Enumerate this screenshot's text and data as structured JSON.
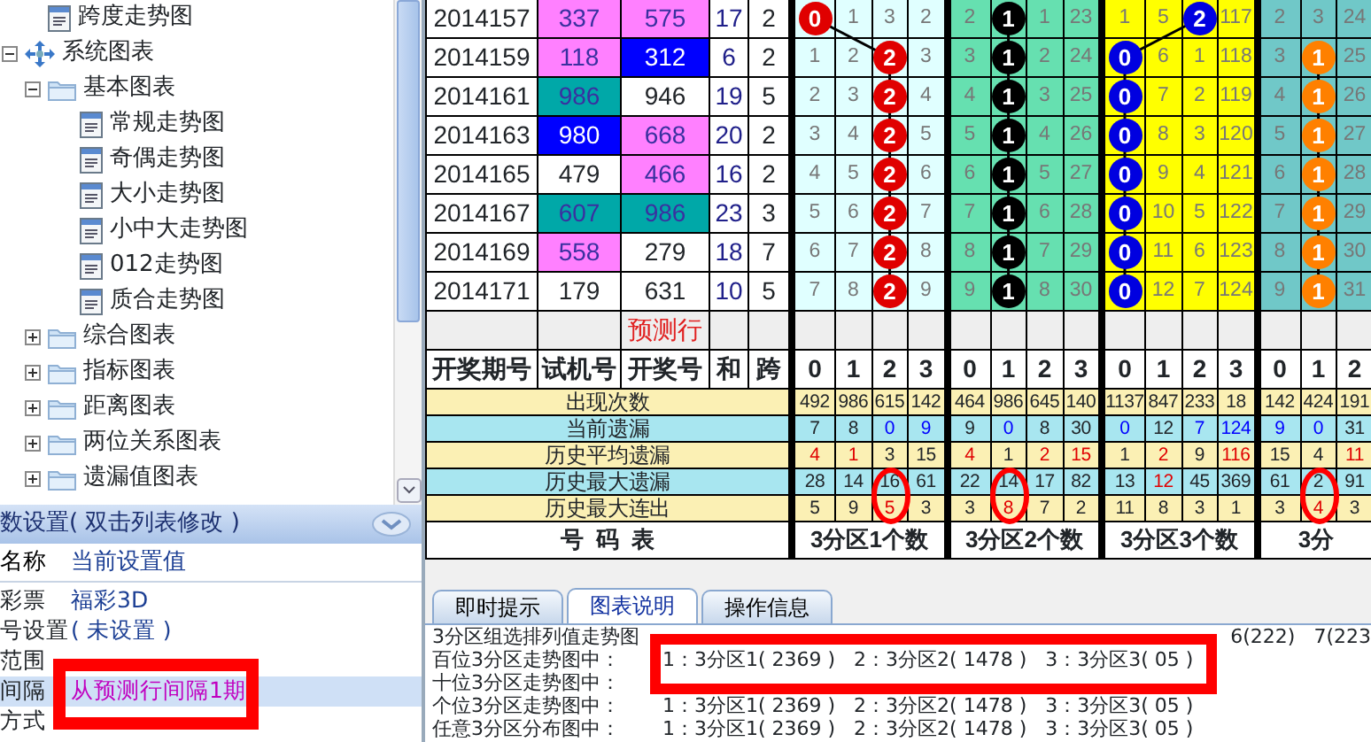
{
  "tree": [
    {
      "children": [
        {
          "kind": "doc",
          "label": "跨度走势图"
        }
      ]
    },
    {
      "kind": "root",
      "label": "系统图表",
      "expanded": true,
      "children": [
        {
          "kind": "folder",
          "label": "基本图表",
          "expanded": true,
          "children": [
            {
              "kind": "doc",
              "label": "常规走势图"
            },
            {
              "kind": "doc",
              "label": "奇偶走势图"
            },
            {
              "kind": "doc",
              "label": "大小走势图"
            },
            {
              "kind": "doc",
              "label": "小中大走势图"
            },
            {
              "kind": "doc",
              "label": "012走势图"
            },
            {
              "kind": "doc",
              "label": "质合走势图"
            }
          ]
        },
        {
          "kind": "folder",
          "label": "综合图表",
          "expanded": false
        },
        {
          "kind": "folder",
          "label": "指标图表",
          "expanded": false
        },
        {
          "kind": "folder",
          "label": "距离图表",
          "expanded": false
        },
        {
          "kind": "folder",
          "label": "两位关系图表",
          "expanded": false
        },
        {
          "kind": "folder",
          "label": "遗漏值图表",
          "expanded": false
        }
      ]
    }
  ],
  "settings": {
    "title": "数设置( 双击列表修改 )",
    "columns": [
      "名称",
      "当前设置值"
    ],
    "rows": [
      {
        "name": "彩票",
        "value": "福彩3D",
        "selected": false
      },
      {
        "name": "号设置",
        "value": "( 未设置 )",
        "selected": false
      },
      {
        "name": "范围",
        "selected": false
      },
      {
        "name": "间隔",
        "value": "从预测行间隔1期",
        "selected": true
      },
      {
        "name": "方式",
        "selected": false
      }
    ]
  },
  "table": {
    "columns": [
      "开奖期号",
      "试机号",
      "开奖号",
      "和",
      "跨"
    ],
    "groups": [
      {
        "color": "#e0ffff",
        "ball": {
          "color": "#e00000"
        },
        "headers": [
          "0",
          "1",
          "2",
          "3"
        ],
        "footer": "3分区1个数"
      },
      {
        "color": "#66e0b0",
        "ball": {
          "color": "#000000"
        },
        "headers": [
          "0",
          "1",
          "2",
          "3"
        ],
        "footer": "3分区2个数"
      },
      {
        "color": "#ffff00",
        "ball": {
          "color": "#0000e0"
        },
        "headers": [
          "0",
          "1",
          "2",
          "3"
        ],
        "footer": "3分区3个数"
      },
      {
        "color": "#70c8c8",
        "ball": {
          "color": "#ff8000"
        },
        "headers": [
          "0",
          "1",
          "2"
        ],
        "footer": "3分"
      }
    ],
    "rows": [
      {
        "period": "2014157",
        "trial": {
          "text": "337",
          "color": "#ff80ff"
        },
        "draw": {
          "text": "575",
          "color": "#ff80ff"
        },
        "sum": "17",
        "span": "2",
        "trend": [
          [
            {
              "text": "0",
              "ball": true
            },
            {
              "text": "1"
            },
            {
              "text": "3"
            },
            {
              "text": "2"
            }
          ],
          [
            {
              "text": "2"
            },
            {
              "text": "1",
              "ball": true
            },
            {
              "text": "1"
            },
            {
              "text": "23"
            }
          ],
          [
            {
              "text": "1"
            },
            {
              "text": "5"
            },
            {
              "text": "2",
              "ball": true
            },
            {
              "text": "117"
            }
          ],
          [
            {
              "text": "2"
            },
            {
              "text": "3"
            },
            {
              "text": "24"
            }
          ]
        ]
      },
      {
        "period": "2014159",
        "trial": {
          "text": "118",
          "color": "#ff80ff"
        },
        "draw": {
          "text": "312",
          "color": "#0000ff"
        },
        "sum": "6",
        "span": "2",
        "trend": [
          [
            {
              "text": "1"
            },
            {
              "text": "2"
            },
            {
              "text": "2",
              "ball": true
            },
            {
              "text": "3"
            }
          ],
          [
            {
              "text": "3"
            },
            {
              "text": "1",
              "ball": true
            },
            {
              "text": "2"
            },
            {
              "text": "24"
            }
          ],
          [
            {
              "text": "0",
              "ball": true
            },
            {
              "text": "6"
            },
            {
              "text": "1"
            },
            {
              "text": "118"
            }
          ],
          [
            {
              "text": "3"
            },
            {
              "text": "1",
              "ball": true
            },
            {
              "text": "25"
            }
          ]
        ]
      },
      {
        "period": "2014161",
        "trial": {
          "text": "986",
          "color": "#00a8a8"
        },
        "draw": {
          "text": "946"
        },
        "sum": "19",
        "span": "5",
        "trend": [
          [
            {
              "text": "2"
            },
            {
              "text": "3"
            },
            {
              "text": "2",
              "ball": true
            },
            {
              "text": "4"
            }
          ],
          [
            {
              "text": "4"
            },
            {
              "text": "1",
              "ball": true
            },
            {
              "text": "3"
            },
            {
              "text": "25"
            }
          ],
          [
            {
              "text": "0",
              "ball": true
            },
            {
              "text": "7"
            },
            {
              "text": "2"
            },
            {
              "text": "119"
            }
          ],
          [
            {
              "text": "4"
            },
            {
              "text": "1",
              "ball": true
            },
            {
              "text": "26"
            }
          ]
        ]
      },
      {
        "period": "2014163",
        "trial": {
          "text": "980",
          "color": "#0000ff"
        },
        "draw": {
          "text": "668",
          "color": "#ff80ff"
        },
        "sum": "20",
        "span": "2",
        "trend": [
          [
            {
              "text": "3"
            },
            {
              "text": "4"
            },
            {
              "text": "2",
              "ball": true
            },
            {
              "text": "5"
            }
          ],
          [
            {
              "text": "5"
            },
            {
              "text": "1",
              "ball": true
            },
            {
              "text": "4"
            },
            {
              "text": "26"
            }
          ],
          [
            {
              "text": "0",
              "ball": true
            },
            {
              "text": "8"
            },
            {
              "text": "3"
            },
            {
              "text": "120"
            }
          ],
          [
            {
              "text": "5"
            },
            {
              "text": "1",
              "ball": true
            },
            {
              "text": "27"
            }
          ]
        ]
      },
      {
        "period": "2014165",
        "trial": {
          "text": "479"
        },
        "draw": {
          "text": "466",
          "color": "#ff80ff"
        },
        "sum": "16",
        "span": "2",
        "trend": [
          [
            {
              "text": "4"
            },
            {
              "text": "5"
            },
            {
              "text": "2",
              "ball": true
            },
            {
              "text": "6"
            }
          ],
          [
            {
              "text": "6"
            },
            {
              "text": "1",
              "ball": true
            },
            {
              "text": "5"
            },
            {
              "text": "27"
            }
          ],
          [
            {
              "text": "0",
              "ball": true
            },
            {
              "text": "9"
            },
            {
              "text": "4"
            },
            {
              "text": "121"
            }
          ],
          [
            {
              "text": "6"
            },
            {
              "text": "1",
              "ball": true
            },
            {
              "text": "28"
            }
          ]
        ]
      },
      {
        "period": "2014167",
        "trial": {
          "text": "607",
          "color": "#00a8a8"
        },
        "draw": {
          "text": "986",
          "color": "#00a8a8"
        },
        "sum": "23",
        "span": "3",
        "trend": [
          [
            {
              "text": "5"
            },
            {
              "text": "6"
            },
            {
              "text": "2",
              "ball": true
            },
            {
              "text": "7"
            }
          ],
          [
            {
              "text": "7"
            },
            {
              "text": "1",
              "ball": true
            },
            {
              "text": "6"
            },
            {
              "text": "28"
            }
          ],
          [
            {
              "text": "0",
              "ball": true
            },
            {
              "text": "10"
            },
            {
              "text": "5"
            },
            {
              "text": "122"
            }
          ],
          [
            {
              "text": "7"
            },
            {
              "text": "1",
              "ball": true
            },
            {
              "text": "29"
            }
          ]
        ]
      },
      {
        "period": "2014169",
        "trial": {
          "text": "558",
          "color": "#ff80ff"
        },
        "draw": {
          "text": "279"
        },
        "sum": "18",
        "span": "7",
        "trend": [
          [
            {
              "text": "6"
            },
            {
              "text": "7"
            },
            {
              "text": "2",
              "ball": true
            },
            {
              "text": "8"
            }
          ],
          [
            {
              "text": "8"
            },
            {
              "text": "1",
              "ball": true
            },
            {
              "text": "7"
            },
            {
              "text": "29"
            }
          ],
          [
            {
              "text": "0",
              "ball": true
            },
            {
              "text": "11"
            },
            {
              "text": "6"
            },
            {
              "text": "123"
            }
          ],
          [
            {
              "text": "8"
            },
            {
              "text": "1",
              "ball": true
            },
            {
              "text": "30"
            }
          ]
        ]
      },
      {
        "period": "2014171",
        "trial": {
          "text": "179"
        },
        "draw": {
          "text": "631"
        },
        "sum": "10",
        "span": "5",
        "trend": [
          [
            {
              "text": "7"
            },
            {
              "text": "8"
            },
            {
              "text": "2",
              "ball": true
            },
            {
              "text": "9"
            }
          ],
          [
            {
              "text": "9"
            },
            {
              "text": "1",
              "ball": true
            },
            {
              "text": "8"
            },
            {
              "text": "30"
            }
          ],
          [
            {
              "text": "0",
              "ball": true
            },
            {
              "text": "12"
            },
            {
              "text": "7"
            },
            {
              "text": "124"
            }
          ],
          [
            {
              "text": "9"
            },
            {
              "text": "1",
              "ball": true
            },
            {
              "text": "31"
            }
          ]
        ]
      }
    ],
    "prediction": {
      "draw": "预测行"
    },
    "stats": [
      {
        "label": "出现次数",
        "values": [
          [
            {
              "text": "492"
            },
            {
              "text": "986"
            },
            {
              "text": "615"
            },
            {
              "text": "142"
            }
          ],
          [
            {
              "text": "464"
            },
            {
              "text": "986"
            },
            {
              "text": "645"
            },
            {
              "text": "140"
            }
          ],
          [
            {
              "text": "1137"
            },
            {
              "text": "847"
            },
            {
              "text": "233"
            },
            {
              "text": "18"
            }
          ],
          [
            {
              "text": "142"
            },
            {
              "text": "424"
            },
            {
              "text": "191"
            }
          ]
        ]
      },
      {
        "label": "当前遗漏",
        "values": [
          [
            {
              "text": "7"
            },
            {
              "text": "8"
            },
            {
              "text": "0",
              "color": "#0000ff"
            },
            {
              "text": "9",
              "color": "#0000ff"
            }
          ],
          [
            {
              "text": "9"
            },
            {
              "text": "0",
              "color": "#0000ff"
            },
            {
              "text": "8"
            },
            {
              "text": "30"
            }
          ],
          [
            {
              "text": "0",
              "color": "#0000ff"
            },
            {
              "text": "12"
            },
            {
              "text": "7",
              "color": "#0000ff"
            },
            {
              "text": "124",
              "color": "#0000ff"
            }
          ],
          [
            {
              "text": "9",
              "color": "#0000ff"
            },
            {
              "text": "0",
              "color": "#0000ff"
            },
            {
              "text": "31"
            }
          ]
        ]
      },
      {
        "label": "历史平均遗漏",
        "values": [
          [
            {
              "text": "4",
              "color": "#e00000"
            },
            {
              "text": "1",
              "color": "#e00000"
            },
            {
              "text": "3"
            },
            {
              "text": "15"
            }
          ],
          [
            {
              "text": "4",
              "color": "#e00000"
            },
            {
              "text": "1"
            },
            {
              "text": "2",
              "color": "#e00000"
            },
            {
              "text": "15",
              "color": "#e00000"
            }
          ],
          [
            {
              "text": "1"
            },
            {
              "text": "2",
              "color": "#e00000"
            },
            {
              "text": "9"
            },
            {
              "text": "116",
              "color": "#e00000"
            }
          ],
          [
            {
              "text": "15"
            },
            {
              "text": "4"
            },
            {
              "text": "11",
              "color": "#e00000"
            }
          ]
        ]
      },
      {
        "label": "历史最大遗漏",
        "values": [
          [
            {
              "text": "28"
            },
            {
              "text": "14"
            },
            {
              "text": "16"
            },
            {
              "text": "61"
            }
          ],
          [
            {
              "text": "22"
            },
            {
              "text": "14"
            },
            {
              "text": "17"
            },
            {
              "text": "82"
            }
          ],
          [
            {
              "text": "13"
            },
            {
              "text": "12",
              "color": "#e00000"
            },
            {
              "text": "45"
            },
            {
              "text": "369"
            }
          ],
          [
            {
              "text": "61"
            },
            {
              "text": "2"
            },
            {
              "text": "91"
            }
          ]
        ]
      },
      {
        "label": "历史最大连出",
        "values": [
          [
            {
              "text": "5"
            },
            {
              "text": "9"
            },
            {
              "text": "5",
              "color": "#e00000"
            },
            {
              "text": "3"
            }
          ],
          [
            {
              "text": "3"
            },
            {
              "text": "8",
              "color": "#e00000"
            },
            {
              "text": "7"
            },
            {
              "text": "2"
            }
          ],
          [
            {
              "text": "11"
            },
            {
              "text": "8"
            },
            {
              "text": "3"
            },
            {
              "text": "1"
            }
          ],
          [
            {
              "text": "3"
            },
            {
              "text": "4",
              "color": "#e00000"
            },
            {
              "text": "3"
            }
          ]
        ]
      }
    ],
    "footer": "号  码  表"
  },
  "tabs": [
    {
      "label": "即时提示",
      "selected": false
    },
    {
      "label": "图表说明",
      "selected": true
    },
    {
      "label": "操作信息",
      "selected": false
    }
  ],
  "notes": [
    {
      "label": "3分区组选排列值走势图",
      "tail": "6(222)   7(223"
    },
    {
      "label": "百位3分区走势图中：",
      "value": "1：3分区1( 2369 )   2：3分区2( 1478 )   3：3分区3( 05 )"
    },
    {
      "label": "十位3分区走势图中："
    },
    {
      "label": "个位3分区走势图中：",
      "value": "1：3分区1( 2369 )   2：3分区2( 1478 )   3：3分区3( 05 )"
    },
    {
      "label": "任意3分区分布图中：",
      "value": "1：3分区1( 2369 )   2：3分区2( 1478 )   3：3分区3( 05 )"
    }
  ]
}
